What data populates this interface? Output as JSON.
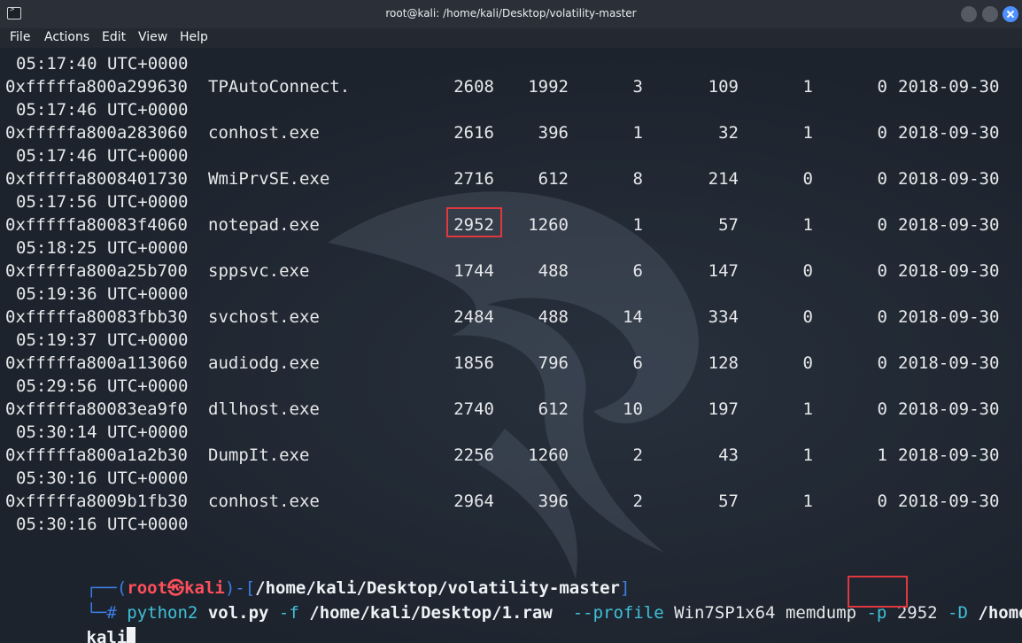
{
  "window": {
    "title": "root@kali: /home/kali/Desktop/volatility-master"
  },
  "menu": [
    "File",
    "Actions",
    "Edit",
    "View",
    "Help"
  ],
  "first_time": "05:17:40 UTC+0000",
  "processes": [
    {
      "offset": "0xfffffa800a299630",
      "name": "TPAutoConnect.",
      "pid": "2608",
      "ppid": "1992",
      "thds": "3",
      "hnds": "109",
      "sess": "1",
      "wow64": "0",
      "date": "2018-09-30",
      "time": "05:17:46 UTC+0000"
    },
    {
      "offset": "0xfffffa800a283060",
      "name": "conhost.exe",
      "pid": "2616",
      "ppid": "396",
      "thds": "1",
      "hnds": "32",
      "sess": "1",
      "wow64": "0",
      "date": "2018-09-30",
      "time": "05:17:46 UTC+0000"
    },
    {
      "offset": "0xfffffa8008401730",
      "name": "WmiPrvSE.exe",
      "pid": "2716",
      "ppid": "612",
      "thds": "8",
      "hnds": "214",
      "sess": "0",
      "wow64": "0",
      "date": "2018-09-30",
      "time": "05:17:56 UTC+0000"
    },
    {
      "offset": "0xfffffa80083f4060",
      "name": "notepad.exe",
      "pid": "2952",
      "ppid": "1260",
      "thds": "1",
      "hnds": "57",
      "sess": "1",
      "wow64": "0",
      "date": "2018-09-30",
      "time": "05:18:25 UTC+0000"
    },
    {
      "offset": "0xfffffa800a25b700",
      "name": "sppsvc.exe",
      "pid": "1744",
      "ppid": "488",
      "thds": "6",
      "hnds": "147",
      "sess": "0",
      "wow64": "0",
      "date": "2018-09-30",
      "time": "05:19:36 UTC+0000"
    },
    {
      "offset": "0xfffffa80083fbb30",
      "name": "svchost.exe",
      "pid": "2484",
      "ppid": "488",
      "thds": "14",
      "hnds": "334",
      "sess": "0",
      "wow64": "0",
      "date": "2018-09-30",
      "time": "05:19:37 UTC+0000"
    },
    {
      "offset": "0xfffffa800a113060",
      "name": "audiodg.exe",
      "pid": "1856",
      "ppid": "796",
      "thds": "6",
      "hnds": "128",
      "sess": "0",
      "wow64": "0",
      "date": "2018-09-30",
      "time": "05:29:56 UTC+0000"
    },
    {
      "offset": "0xfffffa80083ea9f0",
      "name": "dllhost.exe",
      "pid": "2740",
      "ppid": "612",
      "thds": "10",
      "hnds": "197",
      "sess": "1",
      "wow64": "0",
      "date": "2018-09-30",
      "time": "05:30:14 UTC+0000"
    },
    {
      "offset": "0xfffffa800a1a2b30",
      "name": "DumpIt.exe",
      "pid": "2256",
      "ppid": "1260",
      "thds": "2",
      "hnds": "43",
      "sess": "1",
      "wow64": "1",
      "date": "2018-09-30",
      "time": "05:30:16 UTC+0000"
    },
    {
      "offset": "0xfffffa8009b1fb30",
      "name": "conhost.exe",
      "pid": "2964",
      "ppid": "396",
      "thds": "2",
      "hnds": "57",
      "sess": "1",
      "wow64": "0",
      "date": "2018-09-30",
      "time": "05:30:16 UTC+0000"
    }
  ],
  "prompt": {
    "open": "┌──(",
    "user": "root",
    "at": "㉿",
    "host": "kali",
    "mid": ")-[",
    "cwd": "/home/kali/Desktop/volatility-master",
    "close": "]",
    "hash": "└─#",
    "cmd": "python2",
    "script": "vol.py",
    "flag_f": "-f",
    "file": "/home/kali/Desktop/1.raw",
    "flag_profile": "--profile",
    "profile": "Win7SP1x64",
    "plugin": "memdump",
    "flag_p": "-p",
    "pid": "2952",
    "flag_d": "-D",
    "dir_part1": "/home/",
    "dir_part2": "kali"
  },
  "colors": {
    "highlight": "#e0383e",
    "prompt_frame": "#3d7ee6",
    "prompt_user": "#ff4f5a",
    "command": "#3fc1d8"
  }
}
